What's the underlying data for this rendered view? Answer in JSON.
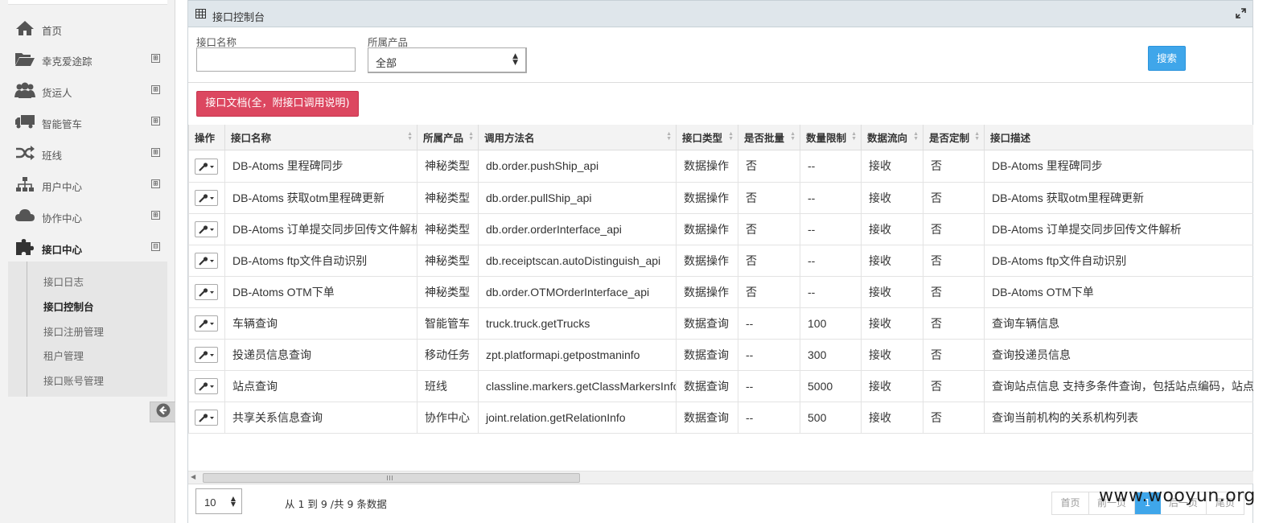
{
  "sidebar": {
    "items": [
      {
        "label": "首页",
        "icon": "home-icon",
        "expandable": false
      },
      {
        "label": "幸克爱途踪",
        "icon": "folder-open-icon",
        "expandable": true
      },
      {
        "label": "货运人",
        "icon": "users-icon",
        "expandable": true
      },
      {
        "label": "智能管车",
        "icon": "truck-icon",
        "expandable": true
      },
      {
        "label": "班线",
        "icon": "shuffle-icon",
        "expandable": true
      },
      {
        "label": "用户中心",
        "icon": "sitemap-icon",
        "expandable": true
      },
      {
        "label": "协作中心",
        "icon": "cloud-icon",
        "expandable": true
      },
      {
        "label": "接口中心",
        "icon": "puzzle-icon",
        "expandable": true,
        "expanded": true
      }
    ],
    "submenu": [
      "接口日志",
      "接口控制台",
      "接口注册管理",
      "租户管理",
      "接口账号管理"
    ],
    "submenu_current": "接口控制台",
    "expand_glyph": "⊞",
    "collapse_glyph": "⊟"
  },
  "panel": {
    "title": "接口控制台",
    "filters": {
      "name_label": "接口名称",
      "name_value": "",
      "product_label": "所属产品",
      "product_value": "全部"
    },
    "search_label": "搜索",
    "doc_button_label": "接口文档(全，附接口调用说明)"
  },
  "table": {
    "columns": [
      "操作",
      "接口名称",
      "所属产品",
      "调用方法名",
      "接口类型",
      "是否批量",
      "数量限制",
      "数据流向",
      "是否定制",
      "接口描述"
    ],
    "rows": [
      [
        "DB-Atoms 里程碑同步",
        "神秘类型",
        "db.order.pushShip_api",
        "数据操作",
        "否",
        "--",
        "接收",
        "否",
        "DB-Atoms 里程碑同步"
      ],
      [
        "DB-Atoms 获取otm里程碑更新",
        "神秘类型",
        "db.order.pullShip_api",
        "数据操作",
        "否",
        "--",
        "接收",
        "否",
        "DB-Atoms 获取otm里程碑更新"
      ],
      [
        "DB-Atoms 订单提交同步回传文件解析",
        "神秘类型",
        "db.order.orderInterface_api",
        "数据操作",
        "否",
        "--",
        "接收",
        "否",
        "DB-Atoms 订单提交同步回传文件解析"
      ],
      [
        "DB-Atoms ftp文件自动识别",
        "神秘类型",
        "db.receiptscan.autoDistinguish_api",
        "数据操作",
        "否",
        "--",
        "接收",
        "否",
        "DB-Atoms ftp文件自动识别"
      ],
      [
        "DB-Atoms OTM下单",
        "神秘类型",
        "db.order.OTMOrderInterface_api",
        "数据操作",
        "否",
        "--",
        "接收",
        "否",
        "DB-Atoms OTM下单"
      ],
      [
        "车辆查询",
        "智能管车",
        "truck.truck.getTrucks",
        "数据查询",
        "--",
        "100",
        "接收",
        "否",
        "查询车辆信息"
      ],
      [
        "投递员信息查询",
        "移动任务",
        "zpt.platformapi.getpostmaninfo",
        "数据查询",
        "--",
        "300",
        "接收",
        "否",
        "查询投递员信息"
      ],
      [
        "站点查询",
        "班线",
        "classline.markers.getClassMarkersInfo",
        "数据查询",
        "--",
        "5000",
        "接收",
        "否",
        "查询站点信息 支持多条件查询，包括站点编码，站点id，站"
      ],
      [
        "共享关系信息查询",
        "协作中心",
        "joint.relation.getRelationInfo",
        "数据查询",
        "--",
        "500",
        "接收",
        "否",
        "查询当前机构的关系机构列表"
      ]
    ]
  },
  "footer": {
    "page_size": "10",
    "record_info": "从 1 到 9 /共 9 条数据",
    "pager": [
      "首页",
      "前一页",
      "1",
      "后一页",
      "尾页"
    ],
    "current_page": "1"
  },
  "watermark": "www.wooyun.org",
  "colors": {
    "accent_blue": "#3fa6ea",
    "danger_red": "#dc4760",
    "header_bg": "#dfe6eb",
    "sidebar_bg": "#f2f2f2"
  }
}
